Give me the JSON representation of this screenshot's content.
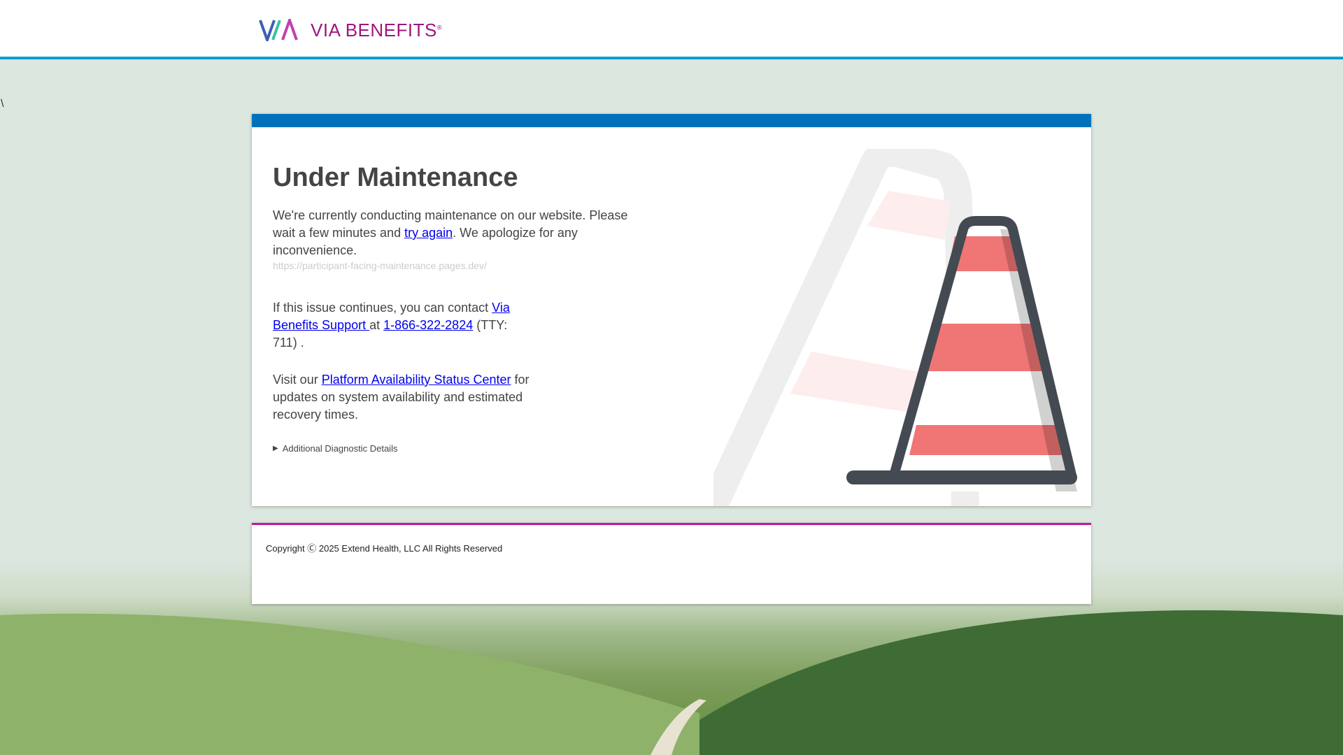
{
  "logo": {
    "text": "VIA BENEFITS",
    "reg": "®"
  },
  "stray_char": "\\",
  "main": {
    "title": "Under Maintenance",
    "p1_before": "We're currently conducting maintenance on our website. Please wait a few minutes and ",
    "p1_link": "try again",
    "p1_after": ". We apologize for any inconvenience.",
    "url": "https://participant-facing-maintenance.pages.dev/",
    "p2_before": "If this issue continues, you can contact ",
    "p2_link": "Via Benefits Support ",
    "p2_mid": "at ",
    "p2_phone": "1-866-322-2824",
    "p2_after": " (TTY: 711) .",
    "p3_before": "Visit our ",
    "p3_link": "Platform Availability Status Center",
    "p3_after": " for updates on system availability and estimated recovery times.",
    "details": "Additional Diagnostic Details"
  },
  "footer": {
    "copyright": "Copyright Ⓒ  2025  Extend Health, LLC All Rights Reserved"
  },
  "colors": {
    "brand": "#a0157f",
    "header_line": "#0aa0d2",
    "card_bar": "#0072bc",
    "footer_line": "#c5169e",
    "cone": "#f07575"
  }
}
